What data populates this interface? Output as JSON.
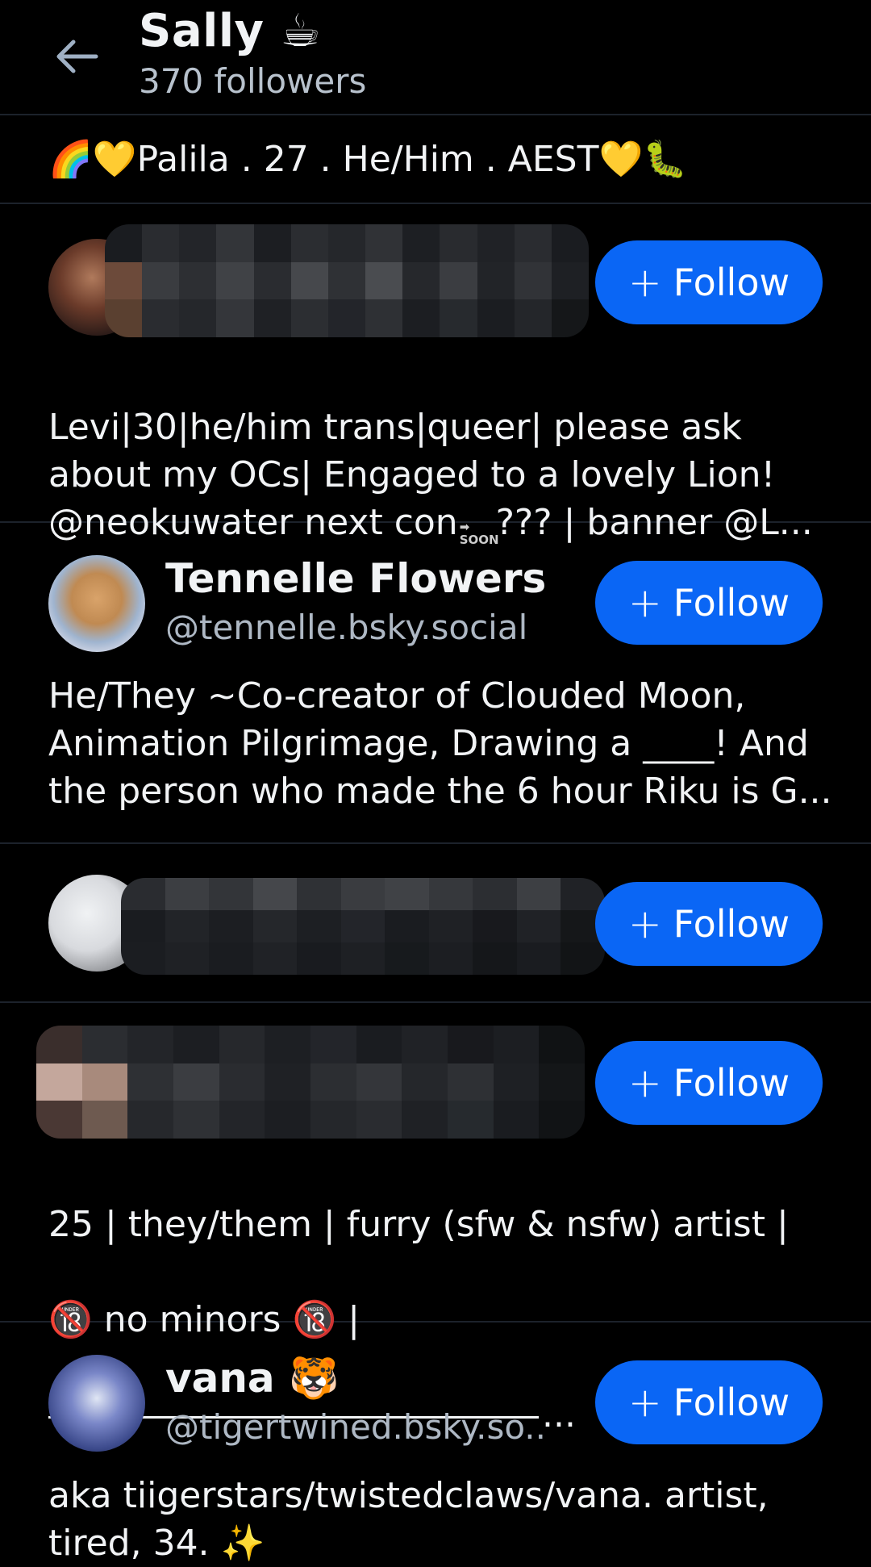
{
  "header": {
    "title": "Sally ☕",
    "followers": "370 followers"
  },
  "bio": {
    "prefix": "🌈💛",
    "text": " Palila . 27 . He/Him . AEST ",
    "suffix": "💛🐛"
  },
  "follow_label": "Follow",
  "cards": [
    {
      "name": "",
      "handle": "",
      "redacted": true,
      "description": "Levi|30|he/him trans|queer| please ask about my OCs| Engaged to a lovely Lion! @neokuwater next con",
      "description_soon": "SOON",
      "description_after": "??? | banner @L..."
    },
    {
      "name": "Tennelle Flowers",
      "handle": "@tennelle.bsky.social",
      "description": "He/They ~Co-creator of Clouded Moon, Animation Pilgrimage, Drawing a ____! And the person who made the 6 hour Riku is G..."
    },
    {
      "name": "",
      "handle": "",
      "redacted": true,
      "description": ""
    },
    {
      "name": "",
      "handle": "",
      "redacted": true,
      "description_line1": "25 | they/them | furry (sfw & nsfw) artist |",
      "description_line2": "🔞 no minors 🔞 |",
      "description_line3": "..."
    },
    {
      "name": "vana 🐯",
      "handle": "@tigertwined.bsky.so..",
      "description": "aka tiigerstars/twistedclaws/vana. artist, tired, 34. ✨"
    }
  ],
  "colors": {
    "background": "#000000",
    "follow_button": "#0a66f5",
    "divider": "#1c222b",
    "secondary_text": "#aeb8c4"
  },
  "icons": {
    "back": "arrow-left-icon",
    "follow": "plus-icon"
  }
}
